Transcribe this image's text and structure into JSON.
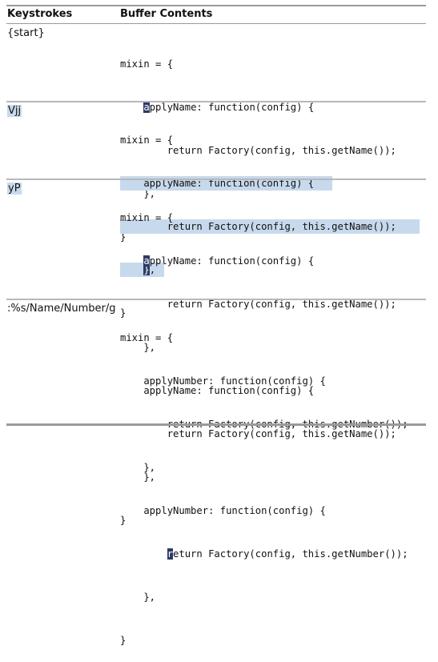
{
  "headers": {
    "keystrokes": "Keystrokes",
    "buffer": "Buffer Contents"
  },
  "rows": [
    {
      "keys": "{start}",
      "keys_highlight": false,
      "lines": [
        "mixin = {",
        "    applyName: function(config) {",
        "        return Factory(config, this.getName());",
        "    },",
        "}"
      ],
      "cursor": {
        "line": 1,
        "col": 4
      }
    },
    {
      "keys": "Vjj",
      "keys_highlight": true,
      "lines": [
        "mixin = {",
        "    applyName: function(config) {",
        "        return Factory(config, this.getName());",
        "    },",
        "}"
      ],
      "cursor": {
        "line": 3,
        "col": 4
      }
    },
    {
      "keys": "yP",
      "keys_highlight": true,
      "lines": [
        "mixin = {",
        "    applyName: function(config) {",
        "        return Factory(config, this.getName());",
        "    },",
        "    applyName: function(config) {",
        "        return Factory(config, this.getName());",
        "    },",
        "}"
      ],
      "cursor": {
        "line": 1,
        "col": 4
      }
    },
    {
      "keys": ":%s/Name/Number/g",
      "keys_highlight": false,
      "lines": [
        "mixin = {",
        "    applyNumber: function(config) {",
        "        return Factory(config, this.getNumber());",
        "    },",
        "    applyNumber: function(config) {",
        "        return Factory(config, this.getNumber());",
        "    },",
        "}"
      ],
      "cursor": {
        "line": 5,
        "col": 8
      }
    }
  ],
  "colors": {
    "selection": "#c7d9ec",
    "cursor": "#2e3a66",
    "rule": "#9a9a9a"
  }
}
